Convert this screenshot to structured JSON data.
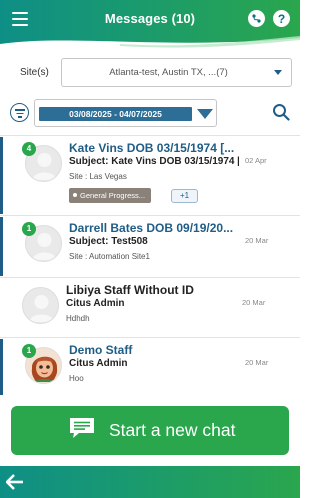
{
  "header": {
    "title": "Messages (10)",
    "menu_icon": "hamburger-menu-icon",
    "route_icon": "route-icon",
    "help_label": "?"
  },
  "filters": {
    "site_label": "Site(s)",
    "site_value": "Atlanta-test, Austin TX, ...(7)",
    "date_range": "03/08/2025 - 04/07/2025",
    "filter_icon": "filter-icon",
    "search_icon": "search-icon"
  },
  "chats": [
    {
      "name": "Kate Vins DOB 03/15/1974 [...",
      "subject": "Subject: Kate Vins DOB 03/15/1974 [",
      "site": "Site : Las Vegas",
      "date": "02 Apr",
      "unread_count": "4",
      "unread": true,
      "tag": "General Progress...",
      "more_tags": "+1"
    },
    {
      "name": "Darrell Bates DOB 09/19/20...",
      "subject": "Subject: Test508",
      "site": "Site : Automation Site1",
      "date": "20 Mar",
      "unread_count": "1",
      "unread": true
    },
    {
      "name": "Libiya Staff Without ID",
      "subject": "Citus Admin",
      "site": "Hdhdh",
      "date": "20 Mar",
      "unread": false
    },
    {
      "name": "Demo Staff",
      "subject": "Citus Admin",
      "site": "Hoo",
      "date": "20 Mar",
      "unread_count": "1",
      "unread": true
    }
  ],
  "start_chat": {
    "label": "Start a new chat",
    "icon": "chat-bubble-icon"
  },
  "bottom_bar": {
    "back_icon": "back-arrow-icon"
  },
  "colors": {
    "header_start": "#0e8f86",
    "header_end": "#2aa64d",
    "accent_blue": "#1f5d86",
    "button_green": "#2aa64d"
  }
}
